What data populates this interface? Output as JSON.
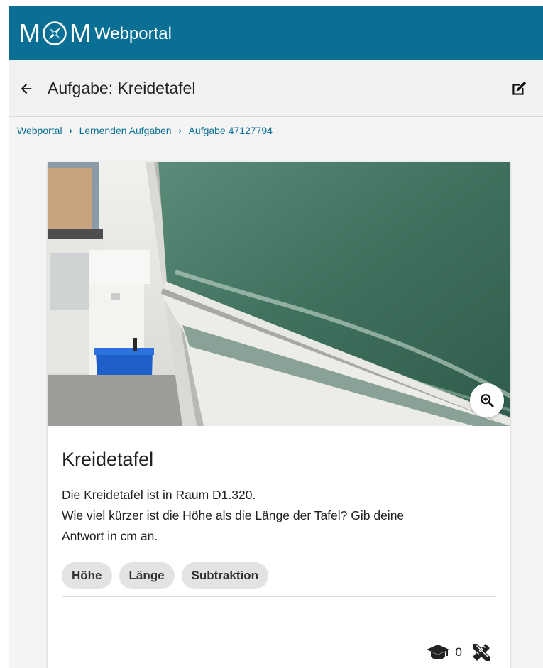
{
  "app": {
    "logo_letters": [
      "M",
      "M"
    ],
    "brand": "Webportal"
  },
  "titlebar": {
    "title": "Aufgabe: Kreidetafel"
  },
  "breadcrumb": {
    "items": [
      "Webportal",
      "Lernenden Aufgaben",
      "Aufgabe 47127794"
    ],
    "separator": "›"
  },
  "task": {
    "title": "Kreidetafel",
    "description_lines": [
      "Die Kreidetafel ist in Raum D1.320.",
      "Wie viel kürzer ist die Höhe als die Länge der Tafel? Gib deine",
      "Antwort in cm an."
    ],
    "tags": [
      "Höhe",
      "Länge",
      "Subtraktion"
    ],
    "solved_count": "0"
  },
  "icons": {
    "back": "arrow-left-icon",
    "edit": "edit-icon",
    "zoom": "zoom-in-icon",
    "students": "graduation-cap-icon",
    "tools": "ruler-pencil-icon"
  },
  "colors": {
    "primary": "#0a6f95",
    "chalkboard": "#3e6f5b",
    "chip": "#e3e3e3"
  }
}
